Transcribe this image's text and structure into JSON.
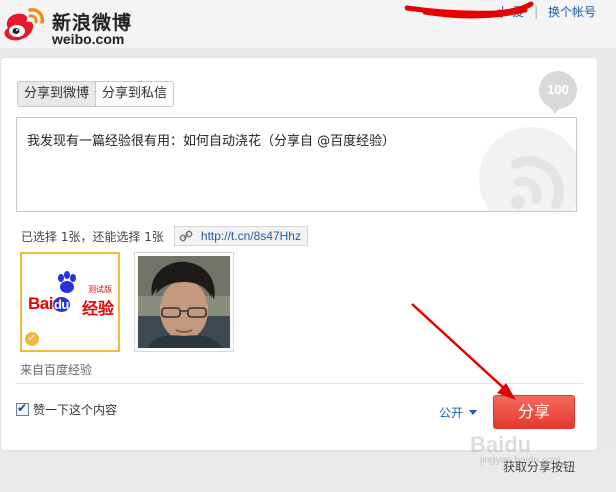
{
  "header": {
    "logo_cn": "新浪微博",
    "logo_en": "weibo.com",
    "account_name": "小     爱",
    "switch_account": "换个帐号"
  },
  "panel": {
    "tabs": [
      {
        "label": "分享到微博",
        "active": true
      },
      {
        "label": "分享到私信",
        "active": false
      }
    ],
    "char_count": "100",
    "message": "我发现有一篇经验很有用：如何自动浇花（分享自 @百度经验）",
    "selection_status": "已选择 1张，还能选择 1张",
    "short_link": "http://t.cn/8s47Hhz",
    "thumbnail_baidu": {
      "brand_left": "Bai",
      "brand_du": "du",
      "brand_right": "经验",
      "beta": "测试版"
    },
    "source": "来自百度经验",
    "like_label": "赞一下这个内容",
    "visibility": "公开",
    "share_button": "分享"
  },
  "footer": {
    "caption": "获取分享按钮",
    "watermark": "Baidu",
    "watermark_sub": "jingyan.baidu.com"
  },
  "colors": {
    "accent_red": "#e2392c",
    "link_blue": "#1f5fa6",
    "selected_border": "#f2b840"
  }
}
